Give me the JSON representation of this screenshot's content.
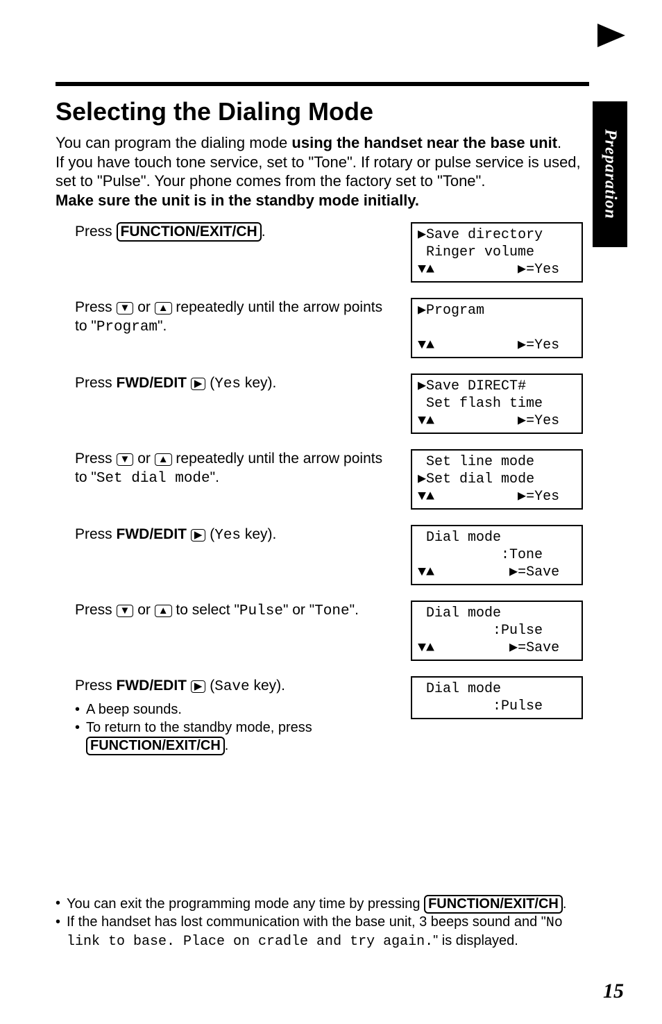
{
  "side_tab": "Preparation",
  "page_number": "15",
  "title": "Selecting the Dialing Mode",
  "intro": {
    "l1a": "You can program the dialing mode ",
    "l1b": "using the handset near the base unit",
    "l1c": ".",
    "l2": "If you have touch tone service, set to \"Tone\". If rotary or pulse service is used, set to \"Pulse\". Your phone comes from the factory set to \"Tone\".",
    "l3": "Make sure the unit is in the standby mode initially."
  },
  "keys": {
    "function_exit_ch": "FUNCTION/EXIT/CH",
    "fwd_edit": "FWD/EDIT",
    "down": "▼",
    "up": "▲",
    "right": "▶"
  },
  "steps": [
    {
      "text_pre": "Press ",
      "text_key": "FUNCTION/EXIT/CH",
      "text_post": ".",
      "lcd": "▶Save directory\n Ringer volume\n▼▲          ▶=Yes"
    },
    {
      "text_parts": [
        "Press ",
        "▼",
        " or ",
        "▲",
        " repeatedly until the arrow points to \"",
        "Program",
        "\"."
      ],
      "lcd": "▶Program\n\n▼▲          ▶=Yes"
    },
    {
      "text_parts": [
        "Press ",
        "FWD/EDIT",
        " ",
        "▶",
        " (",
        "Yes",
        " key)."
      ],
      "lcd": "▶Save DIRECT#\n Set flash time\n▼▲          ▶=Yes"
    },
    {
      "text_parts": [
        "Press ",
        "▼",
        " or ",
        "▲",
        " repeatedly until the arrow points to \"",
        "Set dial mode",
        "\"."
      ],
      "lcd": " Set line mode\n▶Set dial mode\n▼▲          ▶=Yes"
    },
    {
      "text_parts": [
        "Press ",
        "FWD/EDIT",
        " ",
        "▶",
        " (",
        "Yes",
        " key)."
      ],
      "lcd": " Dial mode\n          :Tone\n▼▲         ▶=Save"
    },
    {
      "text_parts": [
        "Press ",
        "▼",
        " or ",
        "▲",
        " to select \"",
        "Pulse",
        "\" or \"",
        "Tone",
        "\"."
      ],
      "lcd": " Dial mode\n         :Pulse\n▼▲         ▶=Save"
    },
    {
      "text_parts": [
        "Press ",
        "FWD/EDIT",
        " ",
        "▶",
        " (",
        "Save",
        " key)."
      ],
      "bullets": [
        "A beep sounds.",
        [
          "To return to the standby mode, press ",
          "FUNCTION/EXIT/CH",
          "."
        ]
      ],
      "lcd": " Dial mode\n         :Pulse\n"
    }
  ],
  "footnotes": [
    [
      "You can exit the programming mode any time by pressing ",
      "FUNCTION/EXIT/CH",
      "."
    ],
    [
      "If the handset has lost communication with the base unit, 3 beeps sound and \"",
      "No link to base. Place on cradle and try again.",
      "\" is displayed."
    ]
  ]
}
